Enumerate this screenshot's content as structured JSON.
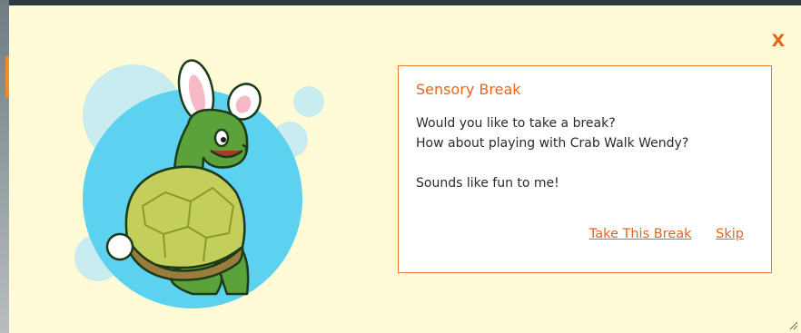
{
  "dialog": {
    "title": "Sensory Break",
    "message_lines": [
      "Would you like to take a break?",
      "How about playing with Crab Walk Wendy?",
      "",
      "Sounds like fun to me!"
    ],
    "take_break_label": "Take This Break",
    "skip_label": "Skip"
  },
  "close_label": "X",
  "mascot": {
    "description_icon": "turtle-bunny-ears-icon"
  },
  "colors": {
    "accent": "#e8641b",
    "panel_bg": "#fffbd6",
    "dialog_border": "#ee7a2e",
    "circle_blue": "#5cd2f0",
    "circle_light": "#c8ecef"
  }
}
